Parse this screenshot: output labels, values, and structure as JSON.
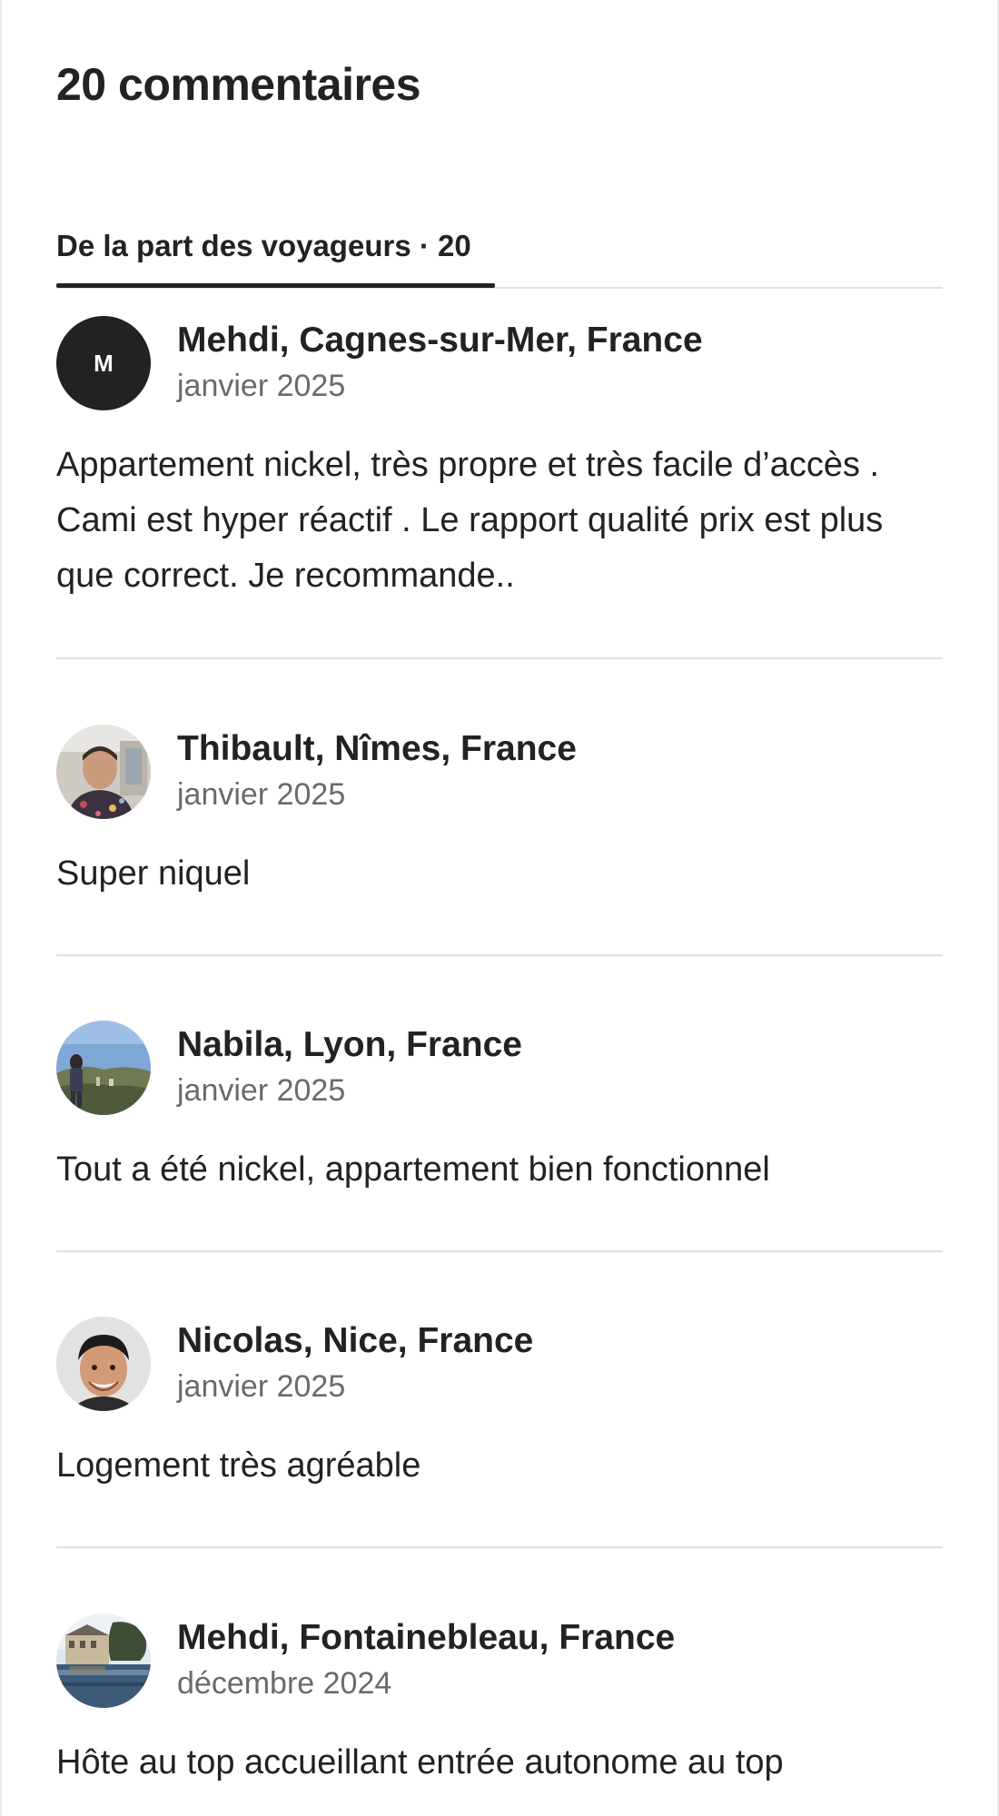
{
  "title": "20 commentaires",
  "tabs": [
    {
      "label": "De la part des voyageurs · 20",
      "active": true
    }
  ],
  "reviews": [
    {
      "name": "Mehdi, Cagnes-sur-Mer, France",
      "date": "janvier 2025",
      "avatar_initial": "M",
      "avatar_type": "initial",
      "text": "Appartement nickel, très propre et très facile d’accès . Cami est hyper réactif . Le rapport qualité prix est plus que correct. Je recommande.."
    },
    {
      "name": "Thibault, Nîmes, France",
      "date": "janvier 2025",
      "avatar_type": "photo",
      "text": "Super niquel"
    },
    {
      "name": "Nabila, Lyon, France",
      "date": "janvier 2025",
      "avatar_type": "photo",
      "text": "Tout a été nickel, appartement bien fonctionnel"
    },
    {
      "name": "Nicolas, Nice, France",
      "date": "janvier 2025",
      "avatar_type": "photo",
      "text": "Logement très agréable"
    },
    {
      "name": "Mehdi, Fontainebleau, France",
      "date": "décembre 2024",
      "avatar_type": "photo",
      "text": "Hôte au top accueillant entrée autonome au top"
    }
  ],
  "colors": {
    "text_primary": "#222222",
    "text_secondary": "#6a6a6a",
    "divider": "#e1e1e1",
    "avatar_initial_bg": "#222222"
  }
}
